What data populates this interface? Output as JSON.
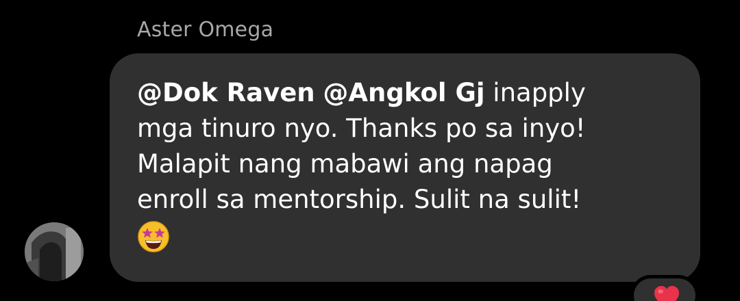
{
  "message": {
    "sender_name": "Aster Omega",
    "mention_1": "@Dok Raven",
    "mention_2": "@Angkol Gj",
    "line_1_rest": " inapply",
    "line_2": "mga tinuro nyo. Thanks po sa inyo!",
    "line_3": "Malapit nang mabawi ang napag",
    "line_4": "enroll sa mentorship. Sulit na sulit!",
    "emoji": "star-struck-emoji",
    "reaction": "heart-icon"
  },
  "colors": {
    "background": "#000000",
    "bubble": "#303030",
    "text": "#ffffff",
    "sender_name": "#a8a8a8",
    "heart": "#e8334a"
  }
}
